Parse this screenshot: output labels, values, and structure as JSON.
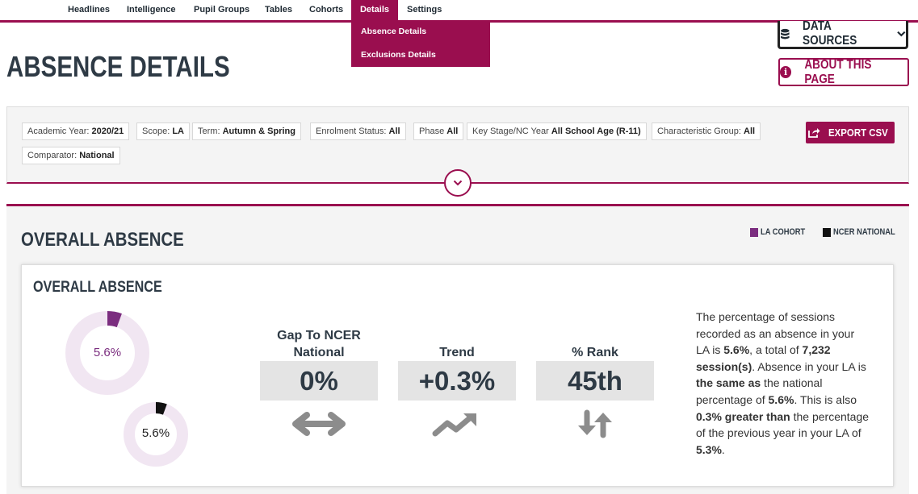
{
  "nav": {
    "items": [
      "Headlines",
      "Intelligence",
      "Pupil Groups",
      "Tables",
      "Cohorts",
      "Details",
      "Settings"
    ],
    "active": "Details",
    "dropdown": [
      "Absence Details",
      "Exclusions Details"
    ]
  },
  "header": {
    "title": "ABSENCE DETAILS",
    "data_sources_label": "DATA SOURCES",
    "about_label": "ABOUT THIS PAGE"
  },
  "filters": {
    "chips": [
      {
        "label": "Academic Year:",
        "value": "2020/21"
      },
      {
        "label": "Scope:",
        "value": "LA"
      },
      {
        "label": "Term:",
        "value": "Autumn & Spring"
      },
      {
        "label": "Enrolment Status:",
        "value": "All"
      },
      {
        "label": "Phase",
        "value": "All"
      },
      {
        "label": "Key Stage/NC Year",
        "value": "All School Age (R-11)"
      },
      {
        "label": "Characteristic Group:",
        "value": "All"
      },
      {
        "label": "Comparator:",
        "value": "National"
      }
    ],
    "export_label": "EXPORT CSV"
  },
  "section": {
    "title": "OVERALL ABSENCE",
    "legend": [
      {
        "label": "LA COHORT",
        "color": "#7b2d7f"
      },
      {
        "label": "NCER NATIONAL",
        "color": "#111111"
      }
    ]
  },
  "card": {
    "title": "OVERALL ABSENCE",
    "donuts": [
      {
        "value_label": "5.6%",
        "percent": 5.6,
        "color": "#7b2d7f",
        "track": "#f1e6f2"
      },
      {
        "value_label": "5.6%",
        "percent": 5.6,
        "color": "#111111",
        "track": "#f1e6f2"
      }
    ],
    "metrics": [
      {
        "label_line1": "Gap To NCER",
        "label_line2": "National",
        "value": "0%",
        "icon": "left-right-arrow-icon"
      },
      {
        "label_line1": "",
        "label_line2": "Trend",
        "value": "+0.3%",
        "icon": "trending-up-icon"
      },
      {
        "label_line1": "",
        "label_line2": "% Rank",
        "value": "45th",
        "icon": "up-down-arrows-icon"
      }
    ],
    "description": {
      "p1": "The percentage of sessions recorded as an absence in your LA is ",
      "b1": "5.6%",
      "p2": ", a total of ",
      "b2": "7,232 session(s)",
      "p3": ". Absence in your LA is ",
      "b3": "the same as",
      "p4": " the national percentage of ",
      "b4": "5.6%",
      "p5": ". This is also ",
      "b5": "0.3% greater than",
      "p6": " the percentage of the previous year in your LA of ",
      "b6": "5.3%",
      "p7": "."
    }
  }
}
